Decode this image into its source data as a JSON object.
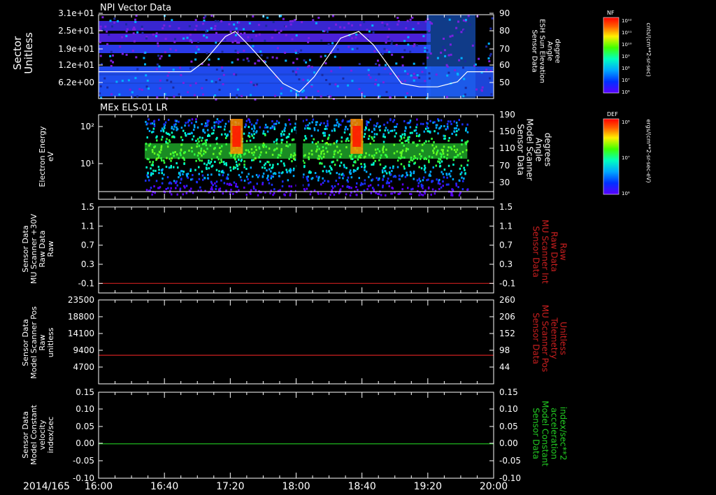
{
  "colors": {
    "red_trace": "#cc1f1f",
    "green_trace": "#22cc22",
    "white": "#ffffff"
  },
  "colorbars": [
    {
      "label": "NF",
      "ticks": [
        "10¹²",
        "10¹¹",
        "10¹⁰",
        "10⁹",
        "10⁸",
        "10⁷",
        "10⁶"
      ],
      "unit": "cnts/(cm**2-sr-sec)"
    },
    {
      "label": "DEF",
      "ticks": [
        "10⁸",
        "10⁷",
        "10⁶"
      ],
      "unit": "ergs/(cm**2-sr-sec-eV)"
    }
  ],
  "time_axis": {
    "date_label": "2014/165",
    "ticks": [
      "16:00",
      "16:40",
      "17:20",
      "18:00",
      "18:40",
      "19:20",
      "20:00"
    ]
  },
  "chart_data": [
    {
      "type": "heatmap",
      "title": "NPI Vector Data",
      "ylabel": "Sector\nUnitless",
      "ytick_labels": [
        "3.1e+01",
        "2.5e+01",
        "1.9e+01",
        "1.2e+01",
        "6.2e+00"
      ],
      "right_ylabel": "Sensor Data\nESH Sun Elevation\nAngle\ndegree",
      "right_ytick_labels": [
        "90",
        "80",
        "70",
        "60",
        "50"
      ],
      "overlay_series": {
        "name": "ESH Sun Elevation Angle",
        "x_time": [
          "16:00",
          "16:56",
          "17:04",
          "17:17",
          "17:23",
          "17:32",
          "17:52",
          "18:02",
          "18:11",
          "18:27",
          "18:38",
          "18:47",
          "19:04",
          "19:15",
          "19:26",
          "19:38",
          "19:44",
          "20:00"
        ],
        "y_deg": [
          56,
          56,
          62,
          77,
          80,
          71,
          49,
          44,
          53,
          76,
          80,
          72,
          49,
          47,
          47,
          50,
          56,
          56
        ]
      }
    },
    {
      "type": "heatmap",
      "title": "MEx ELS-01 LR",
      "ylabel": "Electron Energy\neV",
      "ytick_labels": [
        "10²",
        "10¹"
      ],
      "right_ylabel": "Sensor Data\nModel Scanner\nAngle\ndegrees",
      "right_ytick_labels": [
        "190",
        "150",
        "110",
        "70",
        "30"
      ],
      "data_span": [
        "16:28",
        "19:44"
      ],
      "gap": [
        "18:00",
        "18:04"
      ],
      "peaks_time": [
        "17:20",
        "18:33"
      ]
    },
    {
      "type": "line",
      "ylabel": "Sensor Data\nMU Scanner +30V\nRaw Data\nRaw",
      "ytick_labels": [
        "1.5",
        "1.1",
        "0.7",
        "0.3",
        "-0.1"
      ],
      "ylim": [
        -0.3,
        1.5
      ],
      "right_ylabel": "Sensor Data\nMU Scanner Int\nRaw Data\nRaw",
      "right_ytick_labels": [
        "1.5",
        "1.1",
        "0.7",
        "0.3",
        "-0.1"
      ],
      "series": [
        {
          "values": [
            -0.1,
            -0.1
          ],
          "color": "red"
        }
      ]
    },
    {
      "type": "line",
      "ylabel": "Sensor Data\nModel Scanner Pos\nRaw\nunitless",
      "ytick_labels": [
        "23500",
        "18800",
        "14100",
        "9400",
        "4700"
      ],
      "ylim": [
        0,
        23500
      ],
      "right_ylabel": "Sensor Data\nMU Scanner Pos\nTelemetry\nUnitless",
      "right_ytick_labels": [
        "260",
        "206",
        "152",
        "98",
        "44"
      ],
      "series": [
        {
          "values": [
            8000,
            8000
          ],
          "color": "red"
        }
      ]
    },
    {
      "type": "line",
      "ylabel": "Sensor Data\nModel Constant\nvelocity\nindex/sec",
      "ytick_labels": [
        "0.15",
        "0.10",
        "0.05",
        "0.00",
        "-0.05",
        "-0.10"
      ],
      "ylim": [
        -0.1,
        0.15
      ],
      "right_ylabel": "Sensor Data\nModel Constant\nacceleration\nindex/sec**2",
      "right_ytick_labels": [
        "0.15",
        "0.10",
        "0.05",
        "0.00",
        "-0.05",
        "-0.10"
      ],
      "series": [
        {
          "values": [
            0.0,
            0.0
          ],
          "color": "green"
        }
      ]
    }
  ]
}
